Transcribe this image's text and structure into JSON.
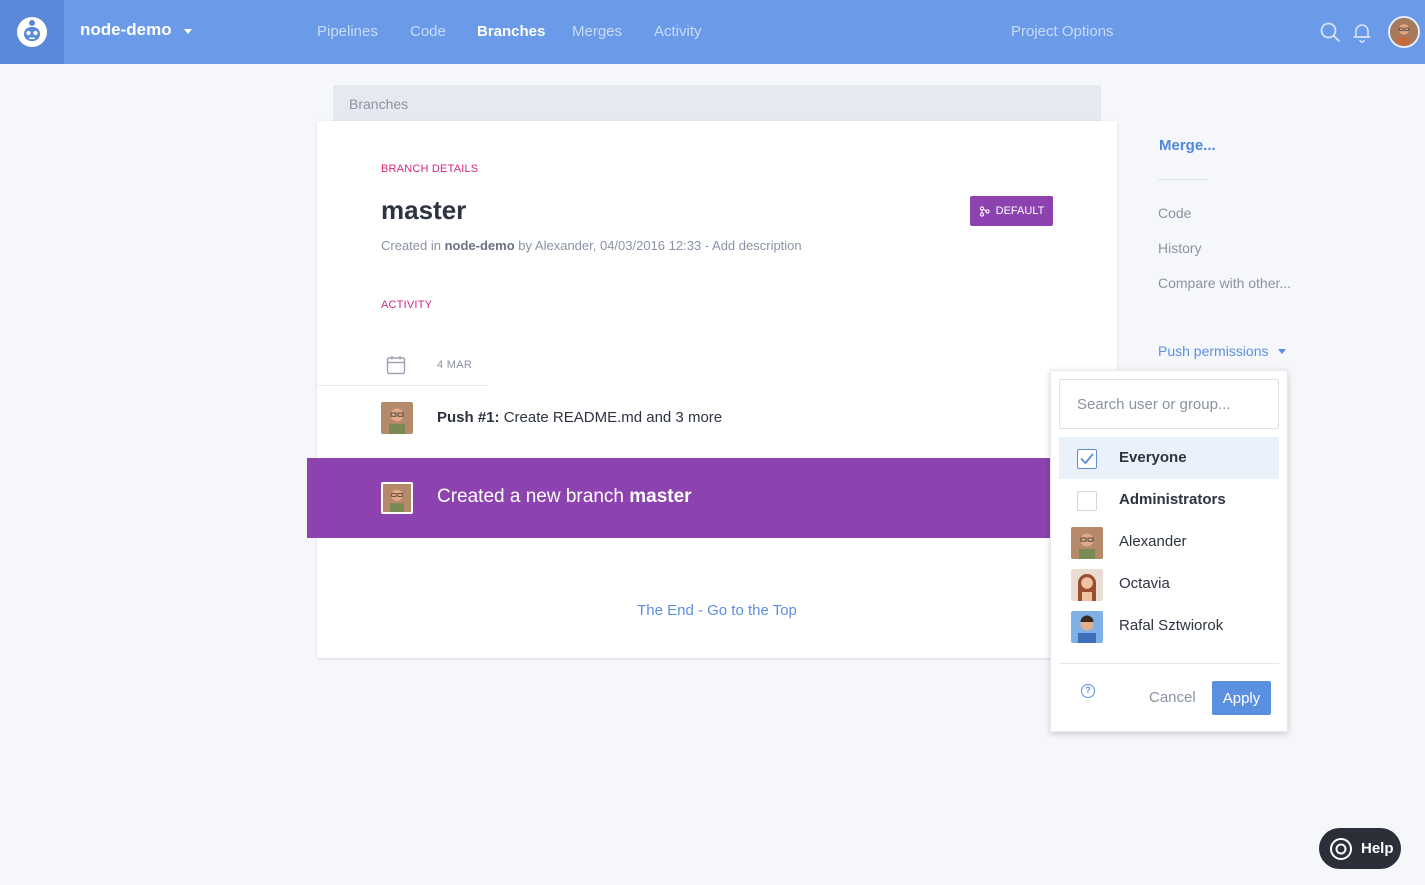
{
  "topbar": {
    "project_name": "node-demo",
    "nav": [
      "Pipelines",
      "Code",
      "Branches",
      "Merges",
      "Activity"
    ],
    "active_nav": "Branches",
    "project_options": "Project Options",
    "icons": [
      "search-icon",
      "bell-icon"
    ]
  },
  "breadcrumb": "Branches",
  "branch": {
    "section_label": "BRANCH DETAILS",
    "name": "master",
    "badge": "DEFAULT",
    "meta_prefix": "Created in",
    "meta_project": "node-demo",
    "meta_suffix": "by Alexander, 04/03/2016 12:33 -",
    "add_description": "Add description"
  },
  "activity": {
    "section_label": "ACTIVITY",
    "date": "4 MAR",
    "push_label": "Push #1:",
    "push_text": "Create README.md and 3 more",
    "created_text": "Created a new branch",
    "created_branch": "master",
    "end_link": "The End - Go to the Top"
  },
  "sidebar": {
    "merge": "Merge...",
    "links": [
      "Code",
      "History",
      "Compare with other..."
    ],
    "push_permissions": "Push permissions"
  },
  "permissions_dropdown": {
    "search_placeholder": "Search user or group...",
    "options": [
      {
        "label": "Everyone",
        "type": "group",
        "checked": true
      },
      {
        "label": "Administrators",
        "type": "group",
        "checked": false
      },
      {
        "label": "Alexander",
        "type": "user"
      },
      {
        "label": "Octavia",
        "type": "user"
      },
      {
        "label": "Rafal Sztwiorok",
        "type": "user"
      }
    ],
    "cancel": "Cancel",
    "apply": "Apply"
  },
  "help_button": "Help",
  "colors": {
    "topbar": "#6b9be8",
    "accent_purple": "#8c43b0",
    "label_pink": "#d6287f",
    "link_blue": "#5b8fe0"
  }
}
